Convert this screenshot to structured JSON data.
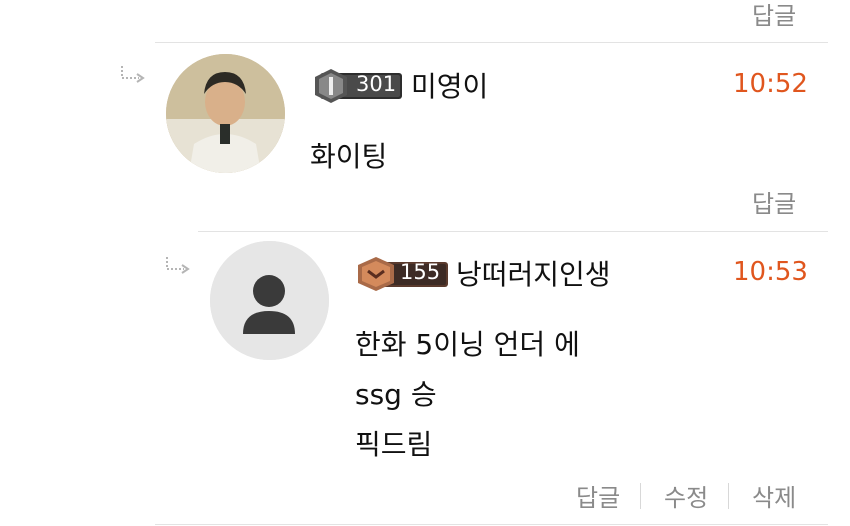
{
  "top": {
    "reply_label": "답글"
  },
  "comments": [
    {
      "level": "301",
      "nickname": "미영이",
      "time": "10:52",
      "lines": [
        "화이팅"
      ],
      "actions": {
        "reply": "답글"
      }
    },
    {
      "level": "155",
      "nickname": "낭떠러지인생",
      "time": "10:53",
      "lines": [
        "한화 5이닝 언더 에",
        "ssg 승",
        "픽드림"
      ],
      "actions": {
        "reply": "답글",
        "edit": "수정",
        "delete": "삭제"
      }
    }
  ],
  "colors": {
    "time": "#e0561e",
    "divider": "#e3e3e3",
    "muted": "#8a8a8a"
  },
  "icons": [
    "reply-arrow-icon",
    "level-badge-icon",
    "default-user-icon"
  ]
}
